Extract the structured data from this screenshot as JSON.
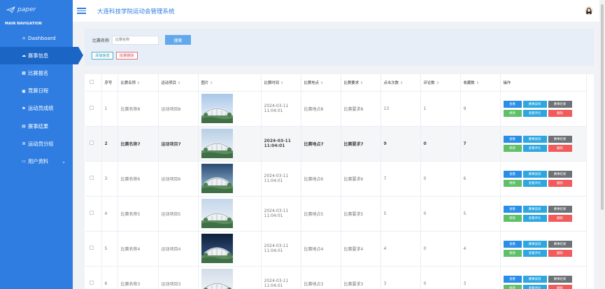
{
  "sidebar": {
    "logo": "paper",
    "section_title": "MAIN NAVIGATION",
    "items": [
      {
        "icon": "home-icon",
        "glyph": "⌂",
        "label": "Dashboard"
      },
      {
        "icon": "chat-icon",
        "glyph": "☁",
        "label": "赛事信息"
      },
      {
        "icon": "grid-icon",
        "glyph": "▦",
        "label": "比赛报名"
      },
      {
        "icon": "apps-icon",
        "glyph": "▣",
        "label": "竞赛日程"
      },
      {
        "icon": "flag-icon",
        "glyph": "⚑",
        "label": "运动员成绩"
      },
      {
        "icon": "calendar-icon",
        "glyph": "▤",
        "label": "赛事结果"
      },
      {
        "icon": "list-icon",
        "glyph": "≣",
        "label": "运动员分组"
      },
      {
        "icon": "card-icon",
        "glyph": "▭",
        "label": "用户资料",
        "chevron": "⌄"
      }
    ]
  },
  "header": {
    "title": "大连科技学院运动会管理系统"
  },
  "search": {
    "label": "比赛名称",
    "placeholder": "比赛名称",
    "button": "搜索",
    "add_button": "添加信息",
    "batch_delete_button": "批量删除"
  },
  "table": {
    "headers": [
      "序号",
      "比赛名称",
      "运动项目",
      "图片",
      "比赛时间",
      "比赛地点",
      "比赛要求",
      "点击次数",
      "评论数",
      "收藏数",
      "操作"
    ],
    "sort_glyph": "⇕",
    "op_labels": {
      "view": "查看",
      "arrange": "赛事安排",
      "result": "赛事结果",
      "edit": "修改",
      "comments": "查看评论",
      "delete": "删除"
    },
    "rows": [
      {
        "idx": "1",
        "name": "比赛名称8",
        "sport": "运动项目8",
        "time": "2024-03-11 11:04:01",
        "place": "比赛地点8",
        "req": "比赛要求8",
        "clicks": "13",
        "comments": "1",
        "favs": "9",
        "bold": false
      },
      {
        "idx": "2",
        "name": "比赛名称7",
        "sport": "运动项目7",
        "time": "2024-03-11 11:04:01",
        "place": "比赛地点7",
        "req": "比赛要求7",
        "clicks": "9",
        "comments": "0",
        "favs": "7",
        "bold": true
      },
      {
        "idx": "3",
        "name": "比赛名称6",
        "sport": "运动项目6",
        "time": "2024-03-11 11:04:01",
        "place": "比赛地点6",
        "req": "比赛要求6",
        "clicks": "7",
        "comments": "0",
        "favs": "6",
        "bold": false
      },
      {
        "idx": "4",
        "name": "比赛名称5",
        "sport": "运动项目5",
        "time": "2024-03-11 11:04:01",
        "place": "比赛地点5",
        "req": "比赛要求5",
        "clicks": "5",
        "comments": "0",
        "favs": "5",
        "bold": false
      },
      {
        "idx": "5",
        "name": "比赛名称4",
        "sport": "运动项目4",
        "time": "2024-03-11 11:04:01",
        "place": "比赛地点4",
        "req": "比赛要求4",
        "clicks": "4",
        "comments": "0",
        "favs": "4",
        "bold": false
      },
      {
        "idx": "6",
        "name": "比赛名称3",
        "sport": "运动项目3",
        "time": "2024-03-11 11:04:01",
        "place": "比赛地点3",
        "req": "比赛要求3",
        "clicks": "3",
        "comments": "0",
        "favs": "3",
        "bold": false
      }
    ]
  },
  "colors": {
    "sidebar": "#2f7de1",
    "sidebar_active": "#1b65c4",
    "primary": "#2a8de8",
    "success": "#60c069",
    "danger": "#f25b5b",
    "neutral": "#6d7276"
  }
}
